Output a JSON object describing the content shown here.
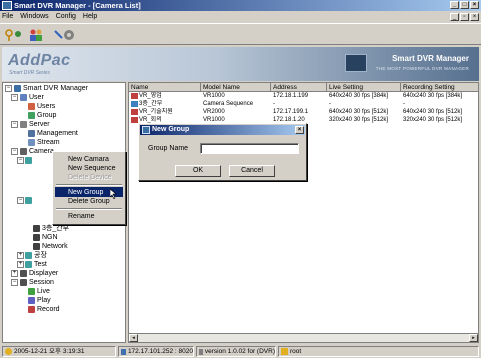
{
  "window": {
    "title": "Smart DVR Manager - [Camera List]"
  },
  "menu": {
    "items": [
      "File",
      "Windows",
      "Config",
      "Help"
    ]
  },
  "banner": {
    "logo": "AddPac",
    "logo_sub": "Smart DVR Series",
    "brand": "Smart DVR Manager",
    "brand_sub": "THE MOST POWERFUL DVR MANAGER"
  },
  "tree": {
    "root": "Smart DVR Manager",
    "user": "User",
    "users": "Users",
    "group": "Group",
    "server": "Server",
    "management": "Management",
    "stream": "Stream",
    "camera": "Camera",
    "node_a": "3층_간부",
    "node_b": "NGN",
    "node_c": "Network",
    "node_d": "공장",
    "node_e": "Test",
    "displayer": "Displayer",
    "session": "Session",
    "live": "Live",
    "play": "Play",
    "record": "Record"
  },
  "grid": {
    "columns": [
      "Name",
      "Model Name",
      "Address",
      "Live Setting",
      "Recording Setting"
    ],
    "rows": [
      [
        "VR_영업",
        "VR1000",
        "172.18.1.199",
        "640x240 30 fps [384k]",
        "640x240 30 fps [384k]"
      ],
      [
        "3층_간부",
        "Camera Sequence",
        "-",
        "-",
        "-"
      ],
      [
        "VR_기술지원",
        "VR2000",
        "172.17.199.1",
        "640x240 30 fps [512k]",
        "640x240 30 fps [512k]"
      ],
      [
        "VR_회의",
        "VR1000",
        "172.18.1.20",
        "320x240 30 fps [512k]",
        "320x240 30 fps [512k]"
      ]
    ]
  },
  "context_menu": {
    "items": [
      "New Camara",
      "New Sequence",
      "Delete Device",
      "New Group",
      "Delete Group",
      "Rename"
    ],
    "highlighted": "New Group"
  },
  "dialog": {
    "title": "New Group",
    "label": "Group Name",
    "value": "",
    "ok": "OK",
    "cancel": "Cancel"
  },
  "status": {
    "datetime": "2005-12-21 오후 3:19:31",
    "ip": "172.17.101.252 : 8020",
    "version": "version 1.0.02 for (DVR)",
    "user": "root"
  },
  "colors": {
    "accent": "#0a246a",
    "banner": "#56708f"
  }
}
